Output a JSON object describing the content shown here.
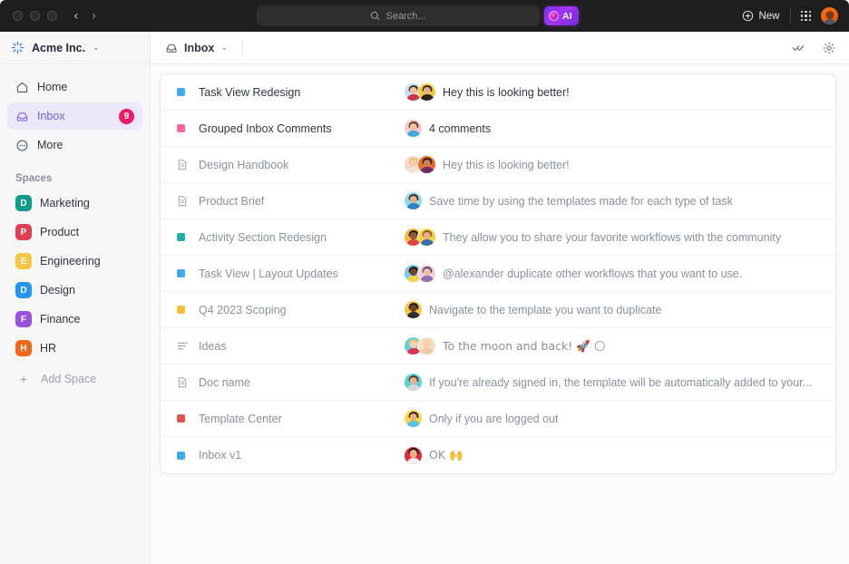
{
  "titlebar": {
    "search_placeholder": "Search...",
    "ai_label": "AI",
    "new_label": "New",
    "traffic_lights": [
      "close",
      "minimize",
      "maximize"
    ],
    "back_arrow": "‹",
    "forward_arrow": "›"
  },
  "sidebar": {
    "workspace": {
      "name": "Acme Inc.",
      "caret": "⌄"
    },
    "nav": [
      {
        "label": "Home",
        "icon": "home-icon",
        "badge": "",
        "active": false
      },
      {
        "label": "Inbox",
        "icon": "inbox-icon",
        "badge": "9",
        "active": true
      },
      {
        "label": "More",
        "icon": "more-icon",
        "badge": "",
        "active": false
      }
    ],
    "spaces_title": "Spaces",
    "spaces": [
      {
        "label": "Marketing",
        "initial": "D",
        "color": "#0f9b8e"
      },
      {
        "label": "Product",
        "initial": "P",
        "color": "#e03e52"
      },
      {
        "label": "Engineering",
        "initial": "E",
        "color": "#f7c444"
      },
      {
        "label": "Design",
        "initial": "D",
        "color": "#2196f3"
      },
      {
        "label": "Finance",
        "initial": "F",
        "color": "#9b51e0"
      },
      {
        "label": "HR",
        "initial": "H",
        "color": "#f2681a"
      }
    ],
    "add_space": {
      "label": "Add Space",
      "plus": "+"
    }
  },
  "main": {
    "tab": {
      "label": "Inbox",
      "caret": "⌄"
    },
    "actions": [
      {
        "name": "mark-all-read-icon"
      },
      {
        "name": "settings-gear-icon"
      }
    ],
    "rows": [
      {
        "title": "Task View Redesign",
        "message": "Hey this is looking better!",
        "icon": "square",
        "icon_color": "#3eaaf0",
        "read": false,
        "avatars": [
          {
            "bg": "#bfe3f2",
            "hair": "#4a3527",
            "skin": "#f0c3a0",
            "body": "#cc2f4a"
          },
          {
            "bg": "#f5c842",
            "hair": "#3a2418",
            "skin": "#e8b089",
            "body": "#2d2520"
          }
        ]
      },
      {
        "title": "Grouped Inbox Comments",
        "message": "4 comments",
        "icon": "square",
        "icon_color": "#f6689b",
        "read": false,
        "avatars": [
          {
            "bg": "#f9c6d9",
            "hair": "#5b3a22",
            "skin": "#f0c3a0",
            "body": "#3fa9e0"
          }
        ]
      },
      {
        "title": "Design Handbook",
        "message": "Hey this is looking better!",
        "icon": "doc",
        "icon_color": "#9aa0ae",
        "read": true,
        "avatars": [
          {
            "bg": "#f3d9c4",
            "hair": "#e8c170",
            "skin": "#f5cdae",
            "body": "#f0e6dc"
          },
          {
            "bg": "#ef6c2a",
            "hair": "#2b1a12",
            "skin": "#c98352",
            "body": "#6a2d6b"
          }
        ]
      },
      {
        "title": "Product Brief",
        "message": "Save time by using the templates made for each type of task",
        "icon": "doc",
        "icon_color": "#9aa0ae",
        "read": true,
        "avatars": [
          {
            "bg": "#8fdcf0",
            "hair": "#3a2a1c",
            "skin": "#e8b089",
            "body": "#2f80c4"
          }
        ]
      },
      {
        "title": "Activity Section Redesign",
        "message": "They allow you to share your favorite workflows with the community",
        "icon": "square",
        "icon_color": "#20b2a6",
        "read": true,
        "avatars": [
          {
            "bg": "#f5b942",
            "hair": "#2b1a12",
            "skin": "#8a5a3b",
            "body": "#d9473f"
          },
          {
            "bg": "#f5d24a",
            "hair": "#8a5a2b",
            "skin": "#e8b089",
            "body": "#3b6ea8"
          }
        ]
      },
      {
        "title": "Task View | Layout Updates",
        "message": "@alexander duplicate other workflows that you want to use.",
        "icon": "square",
        "icon_color": "#3eaaf0",
        "read": true,
        "avatars": [
          {
            "bg": "#7ec8e8",
            "hair": "#241812",
            "skin": "#6d4426",
            "body": "#f0d44a"
          },
          {
            "bg": "#f5cfe0",
            "hair": "#5a4a6b",
            "skin": "#e8c3a8",
            "body": "#8e6fb0"
          }
        ]
      },
      {
        "title": "Q4 2023 Scoping",
        "message": "Navigate to the template you want to duplicate",
        "icon": "square",
        "icon_color": "#f5bf3a",
        "read": true,
        "avatars": [
          {
            "bg": "#f5c842",
            "hair": "#1f140e",
            "skin": "#6d4426",
            "body": "#2b2b33"
          }
        ]
      },
      {
        "title": "Ideas",
        "message": "To the moon and back! 🚀 🌕",
        "icon": "list",
        "icon_color": "#9aa0ae",
        "read": true,
        "avatars": [
          {
            "bg": "#5fd0e0",
            "hair": "#e8c06a",
            "skin": "#f2cfae",
            "body": "#e03050"
          },
          {
            "bg": "#f7ddc6",
            "hair": "#f0dba0",
            "skin": "#f5cfae",
            "body": "#f0c9a8"
          }
        ]
      },
      {
        "title": "Doc name",
        "message": "If you're already signed in, the template will be automatically added to your...",
        "icon": "doc",
        "icon_color": "#9aa0ae",
        "read": true,
        "avatars": [
          {
            "bg": "#56d4d4",
            "hair": "#5b3a22",
            "skin": "#e8b089",
            "body": "#d8d8dc"
          }
        ]
      },
      {
        "title": "Template Center",
        "message": "Only if you are logged out",
        "icon": "square",
        "icon_color": "#e2544e",
        "read": true,
        "avatars": [
          {
            "bg": "#f7d94a",
            "hair": "#2f1f14",
            "skin": "#e8b089",
            "body": "#5bbfe0"
          }
        ]
      },
      {
        "title": "Inbox v1",
        "message": "OK 🙌",
        "icon": "square",
        "icon_color": "#3eaaf0",
        "read": true,
        "avatars": [
          {
            "bg": "#e02b3a",
            "hair": "#231810",
            "skin": "#e8b089",
            "body": "#f2f2f4"
          }
        ]
      }
    ]
  }
}
